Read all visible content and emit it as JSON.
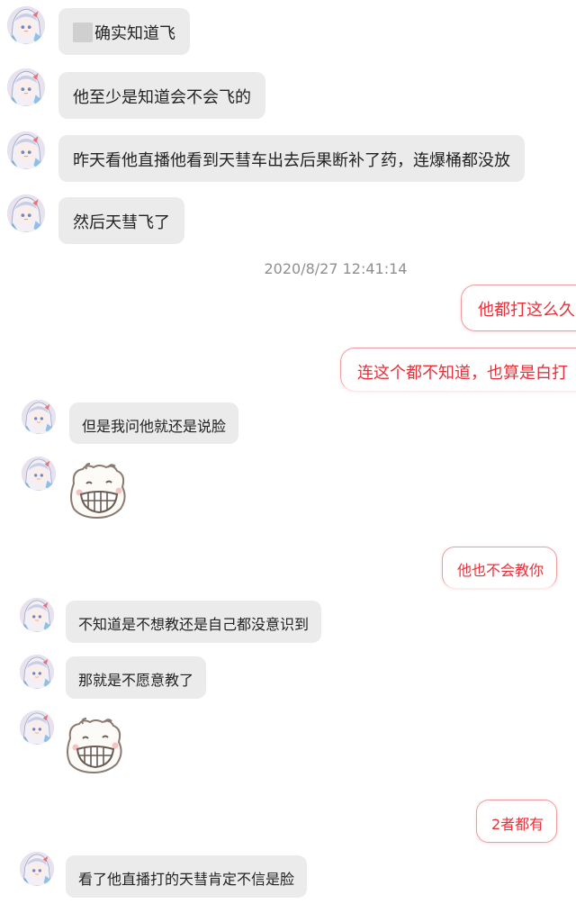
{
  "messages_top": [
    {
      "text": "确实知道飞"
    },
    {
      "text": "他至少是知道会不会飞的"
    },
    {
      "text": "昨天看他直播他看到天彗车出去后果断补了药，连爆桶都没放"
    },
    {
      "text": "然后天彗飞了"
    }
  ],
  "timestamp": "2020/8/27 12:41:14",
  "outgoing": [
    {
      "text": "他都打这么久"
    },
    {
      "text": "连这个都不知道，也算是白打"
    },
    {
      "text": "他也不会教你"
    },
    {
      "text": "2者都有"
    }
  ],
  "messages_bottom": [
    {
      "text": "但是我问他就还是说脸"
    },
    {
      "text": "不知道是不想教还是自己都没意识到"
    },
    {
      "text": "那就是不愿意教了"
    },
    {
      "text": "看了他直播打的天彗肯定不信是脸"
    }
  ],
  "colors": {
    "incoming_bubble": "#ebebeb",
    "outgoing_text": "#e8303a",
    "outgoing_border": "#f19aa0"
  }
}
